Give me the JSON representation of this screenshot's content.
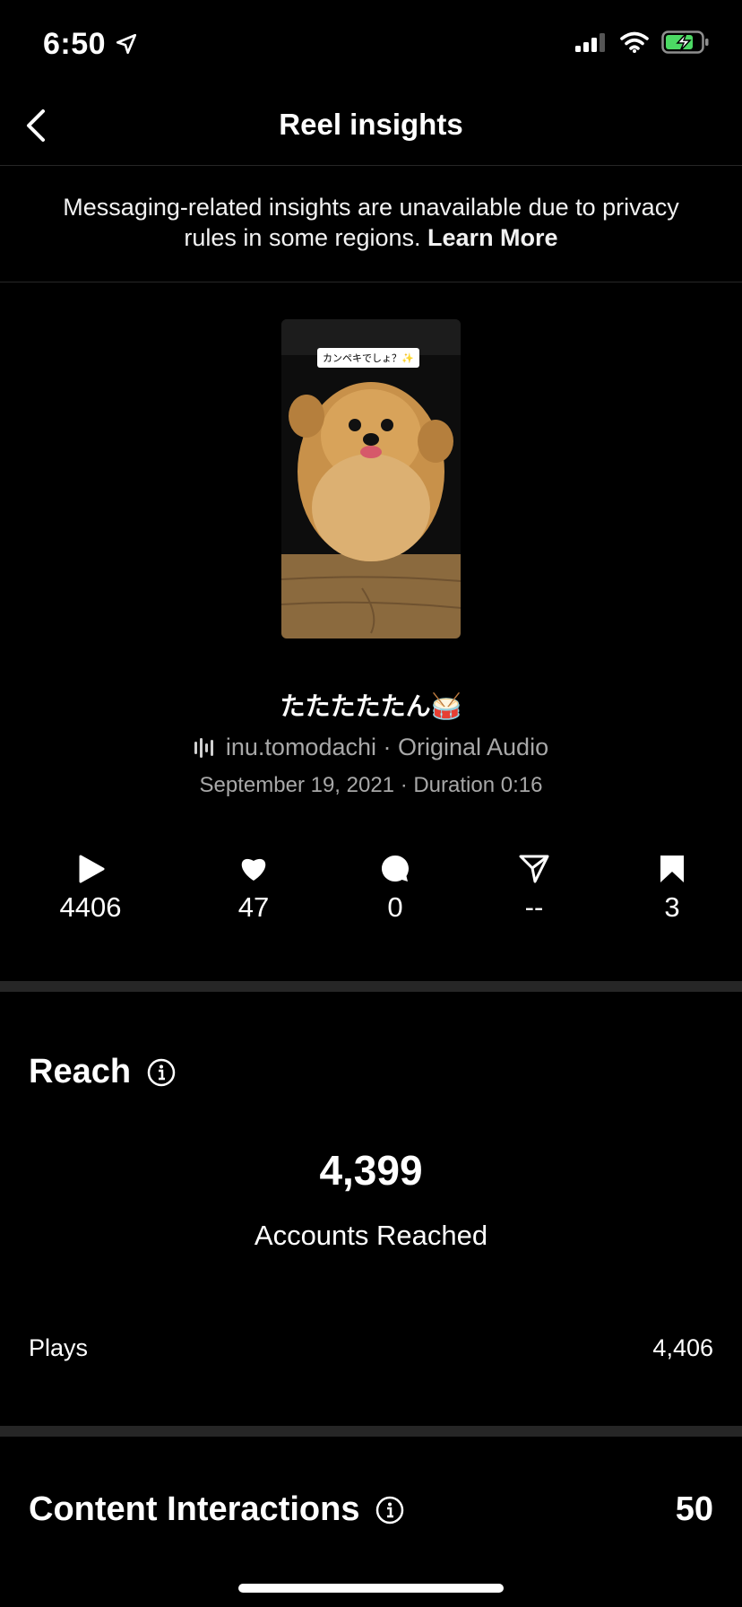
{
  "status_bar": {
    "time": "6:50"
  },
  "nav": {
    "title": "Reel insights"
  },
  "notice": {
    "text": "Messaging-related insights are unavailable due to privacy rules in some regions. ",
    "link": "Learn More"
  },
  "thumbnail": {
    "caption": "カンペキでしょ？✨"
  },
  "reel": {
    "title": "たたたたたん🥁",
    "audio": "inu.tomodachi · Original Audio",
    "meta": "September 19, 2021 · Duration 0:16"
  },
  "stats": [
    {
      "icon": "play-icon",
      "value": "4406"
    },
    {
      "icon": "heart-icon",
      "value": "47"
    },
    {
      "icon": "comment-icon",
      "value": "0"
    },
    {
      "icon": "share-icon",
      "value": "--"
    },
    {
      "icon": "save-icon",
      "value": "3"
    }
  ],
  "reach": {
    "title": "Reach",
    "accounts_reached": "4,399",
    "accounts_label": "Accounts Reached",
    "plays_label": "Plays",
    "plays_value": "4,406"
  },
  "content_interactions": {
    "title": "Content Interactions",
    "value": "50"
  }
}
